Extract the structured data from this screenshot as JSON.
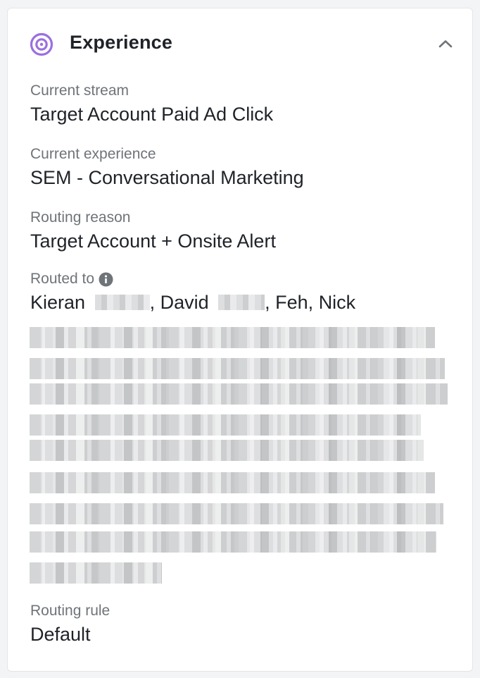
{
  "panel": {
    "title": "Experience",
    "collapse_icon": "chevron-up-icon",
    "header_icon": "target-icon",
    "accent": "#9b6fe0"
  },
  "fields": {
    "current_stream": {
      "label": "Current stream",
      "value": "Target Account Paid Ad Click"
    },
    "current_experience": {
      "label": "Current experience",
      "value": "SEM - Conversational Marketing"
    },
    "routing_reason": {
      "label": "Routing reason",
      "value": "Target Account + Onsite Alert"
    },
    "routed_to": {
      "label": "Routed to",
      "info_icon": "info-icon",
      "people": [
        "Kieran",
        "David",
        "Feh",
        "Nick"
      ]
    },
    "routing_rule": {
      "label": "Routing rule",
      "value": "Default"
    }
  }
}
